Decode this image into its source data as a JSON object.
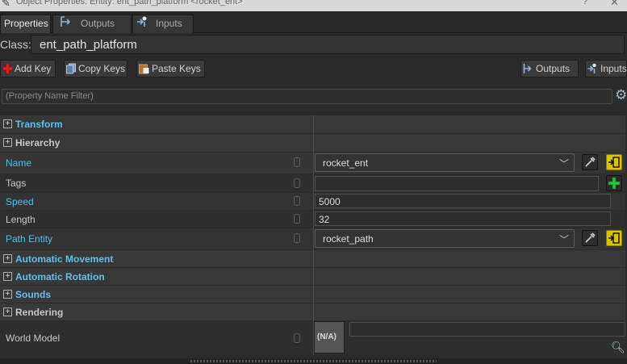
{
  "window": {
    "title": "Object Properties: Entity: ent_path_platform <rocket_ent>",
    "help": "?",
    "close": "✕"
  },
  "tabs": [
    {
      "label": "Properties"
    },
    {
      "label": "Outputs"
    },
    {
      "label": "Inputs"
    }
  ],
  "class": {
    "label": "Class:",
    "value": "ent_path_platform"
  },
  "toolbar": {
    "add_key": "Add Key",
    "copy_keys": "Copy Keys",
    "paste_keys": "Paste Keys",
    "outputs": "Outputs",
    "inputs": "Inputs"
  },
  "filter": {
    "placeholder": "(Property Name Filter)"
  },
  "groups": {
    "transform": "Transform",
    "hierarchy": "Hierarchy",
    "automatic_movement": "Automatic Movement",
    "automatic_rotation": "Automatic Rotation",
    "sounds": "Sounds",
    "rendering": "Rendering"
  },
  "properties": {
    "name": {
      "label": "Name",
      "value": "rocket_ent"
    },
    "tags": {
      "label": "Tags",
      "value": ""
    },
    "speed": {
      "label": "Speed",
      "value": "5000"
    },
    "length": {
      "label": "Length",
      "value": "32"
    },
    "path_entity": {
      "label": "Path Entity",
      "value": "rocket_path"
    },
    "world_model": {
      "label": "World Model",
      "preview": "(N/A)",
      "value": ""
    }
  },
  "colors": {
    "accent_label": "#5fc2e9",
    "yellow_button": "#d8c400",
    "add_green": "#2fbf3a",
    "add_red": "#e02020"
  }
}
